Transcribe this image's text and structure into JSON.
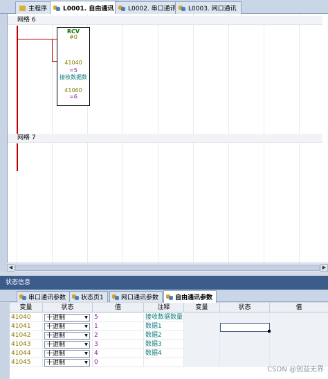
{
  "tabs": [
    {
      "label": "主程序",
      "active": false,
      "icon": "main-program-icon"
    },
    {
      "label": "L0001. 自由通讯",
      "active": true,
      "icon": "subroutine-icon"
    },
    {
      "label": "L0002. 串口通讯",
      "active": false,
      "icon": "subroutine-icon"
    },
    {
      "label": "L0003. 网口通讯",
      "active": false,
      "icon": "subroutine-icon"
    }
  ],
  "editor": {
    "network6": "网络 6",
    "network7": "网络 7",
    "block": {
      "type": "RCV",
      "pin0": "#0",
      "addr1": "41040",
      "val1": "=5",
      "comment1": "接收数据数",
      "addr2": "41060",
      "val2": "=6"
    }
  },
  "status_panel": {
    "title": "状态信息",
    "tabs": [
      {
        "label": "串口通讯参数",
        "active": false
      },
      {
        "label": "状态页1",
        "active": false
      },
      {
        "label": "网口通讯参数",
        "active": false
      },
      {
        "label": "自由通讯参数",
        "active": true
      }
    ],
    "columns": [
      "变量",
      "状态",
      "值",
      "注释",
      "变量",
      "状态",
      "值"
    ],
    "rows": [
      {
        "var": "41040",
        "status": "十进制",
        "value": "5",
        "note": "接收数据数量"
      },
      {
        "var": "41041",
        "status": "十进制",
        "value": "1",
        "note": "数据1"
      },
      {
        "var": "41042",
        "status": "十进制",
        "value": "2",
        "note": "数据2"
      },
      {
        "var": "41043",
        "status": "十进制",
        "value": "3",
        "note": "数据3"
      },
      {
        "var": "41044",
        "status": "十进制",
        "value": "4",
        "note": "数据4"
      },
      {
        "var": "41045",
        "status": "十进制",
        "value": "0",
        "note": ""
      }
    ]
  },
  "watermark": "CSDN @创益无界",
  "colors": {
    "rail": "#c00000",
    "panel_title": "#3b5b8a"
  }
}
